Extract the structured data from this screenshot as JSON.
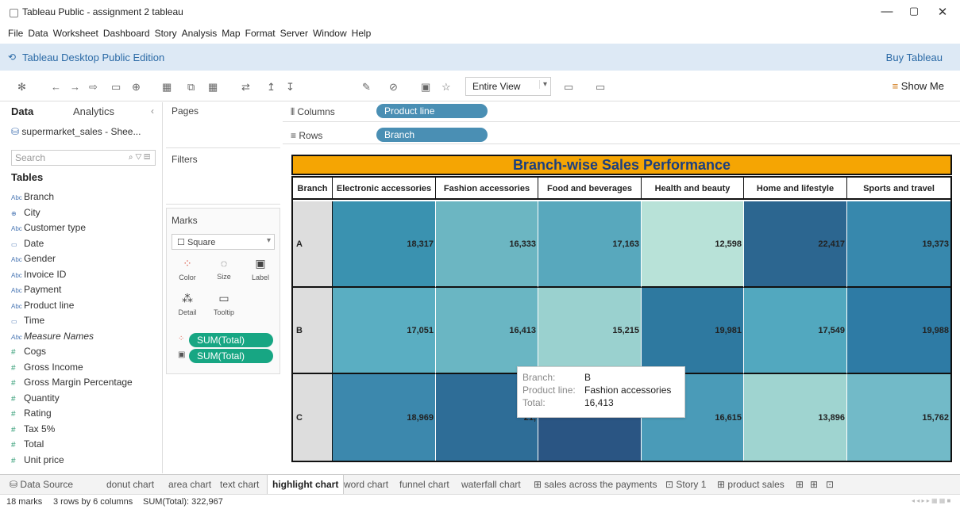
{
  "window": {
    "title": "Tableau Public - assignment 2 tableau",
    "minimize": "—",
    "restore": "▢",
    "close": "✕"
  },
  "menu": [
    "File",
    "Data",
    "Worksheet",
    "Dashboard",
    "Story",
    "Analysis",
    "Map",
    "Format",
    "Server",
    "Window",
    "Help"
  ],
  "edition": {
    "label": "Tableau Desktop Public Edition",
    "buy": "Buy Tableau"
  },
  "toolbar": {
    "view_mode": "Entire View",
    "show_me": "Show Me"
  },
  "datapane": {
    "tab_data": "Data",
    "tab_analytics": "Analytics",
    "datasource": "supermarket_sales - Shee...",
    "search_placeholder": "Search",
    "tables_heading": "Tables",
    "fields": [
      {
        "name": "Branch",
        "icon": "Abc",
        "kind": "dim"
      },
      {
        "name": "City",
        "icon": "⊕",
        "kind": "dim"
      },
      {
        "name": "Customer type",
        "icon": "Abc",
        "kind": "dim"
      },
      {
        "name": "Date",
        "icon": "▭",
        "kind": "dim"
      },
      {
        "name": "Gender",
        "icon": "Abc",
        "kind": "dim"
      },
      {
        "name": "Invoice ID",
        "icon": "Abc",
        "kind": "dim"
      },
      {
        "name": "Payment",
        "icon": "Abc",
        "kind": "dim"
      },
      {
        "name": "Product line",
        "icon": "Abc",
        "kind": "dim"
      },
      {
        "name": "Time",
        "icon": "▭",
        "kind": "dim"
      },
      {
        "name": "Measure Names",
        "icon": "Abc",
        "kind": "dim"
      },
      {
        "name": "Cogs",
        "icon": "#",
        "kind": "meas"
      },
      {
        "name": "Gross Income",
        "icon": "#",
        "kind": "meas"
      },
      {
        "name": "Gross Margin Percentage",
        "icon": "#",
        "kind": "meas"
      },
      {
        "name": "Quantity",
        "icon": "#",
        "kind": "meas"
      },
      {
        "name": "Rating",
        "icon": "#",
        "kind": "meas"
      },
      {
        "name": "Tax 5%",
        "icon": "#",
        "kind": "meas"
      },
      {
        "name": "Total",
        "icon": "#",
        "kind": "meas"
      },
      {
        "name": "Unit price",
        "icon": "#",
        "kind": "meas"
      }
    ]
  },
  "cards": {
    "pages": "Pages",
    "filters": "Filters",
    "marks": "Marks",
    "mark_type": "Square",
    "buttons": [
      "Color",
      "Size",
      "Label",
      "Detail",
      "Tooltip"
    ],
    "pills": [
      "SUM(Total)",
      "SUM(Total)"
    ]
  },
  "shelves": {
    "columns_label": "Columns",
    "columns_pill": "Product line",
    "rows_label": "Rows",
    "rows_pill": "Branch"
  },
  "chart_data": {
    "type": "heatmap",
    "title": "Branch-wise Sales Performance",
    "row_header": "Branch",
    "columns": [
      "Electronic accessories",
      "Fashion accessories",
      "Food and beverages",
      "Health and beauty",
      "Home and lifestyle",
      "Sports and travel"
    ],
    "rows": [
      "A",
      "B",
      "C"
    ],
    "values": [
      [
        "18,317",
        "16,333",
        "17,163",
        "12,598",
        "22,417",
        "19,373"
      ],
      [
        "17,051",
        "16,413",
        "15,215",
        "19,981",
        "17,549",
        "19,988"
      ],
      [
        "18,969",
        "21,",
        "",
        "16,615",
        "13,896",
        "15,762"
      ]
    ],
    "colors": [
      [
        "#3a92b0",
        "#6cb6c2",
        "#58a8bd",
        "#b8e2d8",
        "#2c6690",
        "#3788ad"
      ],
      [
        "#5aaec2",
        "#6ab6c3",
        "#9ad1cf",
        "#2e79a0",
        "#52a8bf",
        "#2e7ba5"
      ],
      [
        "#3c88ad",
        "#2e6d97",
        "#2a5583",
        "#4a9bb8",
        "#9fd4d0",
        "#72bac8"
      ]
    ]
  },
  "tooltip": {
    "branch_k": "Branch:",
    "branch_v": "B",
    "pl_k": "Product line:",
    "pl_v": "Fashion accessories",
    "total_k": "Total:",
    "total_v": "16,413"
  },
  "sheet_tabs": {
    "datasource": "Data Source",
    "tabs": [
      "donut chart",
      "area chart",
      "text chart",
      "highlight chart",
      "word chart",
      "funnel chart",
      "waterfall chart",
      "sales across the payments",
      "Story 1",
      "product sales"
    ],
    "active": "highlight chart"
  },
  "status": {
    "marks": "18 marks",
    "dims": "3 rows by 6 columns",
    "sum": "SUM(Total): 322,967"
  }
}
